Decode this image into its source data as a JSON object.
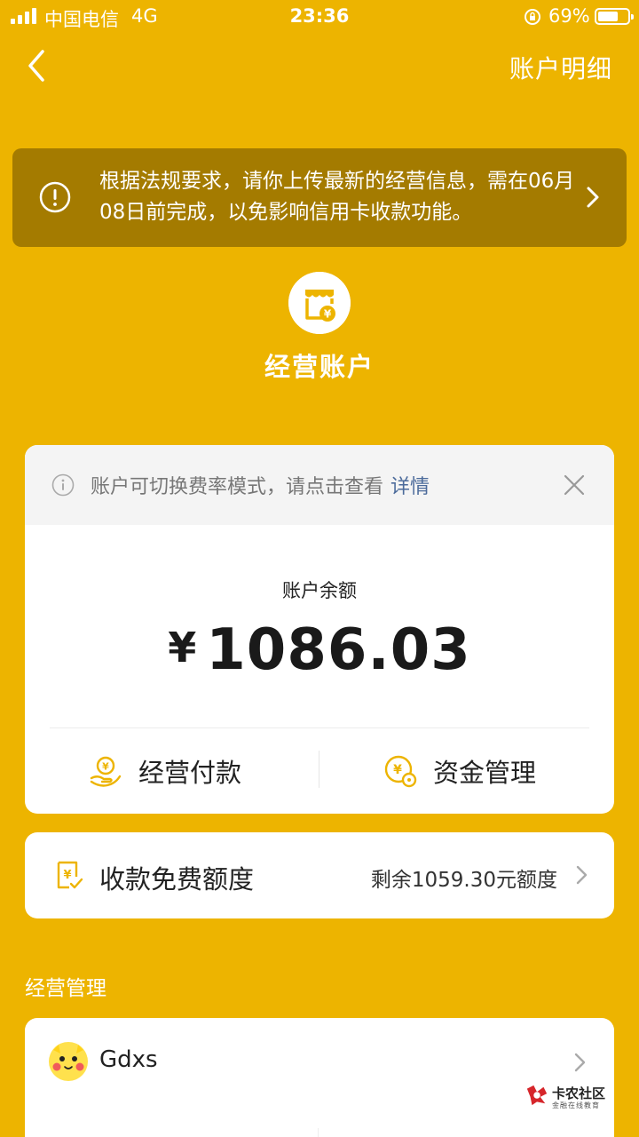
{
  "status_bar": {
    "carrier": "中国电信",
    "network": "4G",
    "time": "23:36",
    "battery": "69%",
    "battery_level": 0.69
  },
  "nav": {
    "title_right": "账户明细"
  },
  "banner": {
    "text": "根据法规要求，请你上传最新的经营信息，需在06月08日前完成，以免影响信用卡收款功能。"
  },
  "account": {
    "title": "经营账户"
  },
  "notice": {
    "text": "账户可切换费率模式，请点击查看",
    "link": "详情"
  },
  "balance": {
    "label": "账户余额",
    "currency": "¥",
    "amount": "1086.03"
  },
  "actions": {
    "pay": "经营付款",
    "fund": "资金管理"
  },
  "quota": {
    "title": "收款免费额度",
    "remaining": "剩余1059.30元额度"
  },
  "section": {
    "title": "经营管理"
  },
  "merchant": {
    "name": "Gdxs"
  },
  "watermark": {
    "title": "卡农社区",
    "subtitle": "金融在线教育"
  },
  "colors": {
    "background": "#EDB400",
    "banner": "#A47B00",
    "accent_icon": "#EDB400",
    "link": "#4C6B9B"
  }
}
